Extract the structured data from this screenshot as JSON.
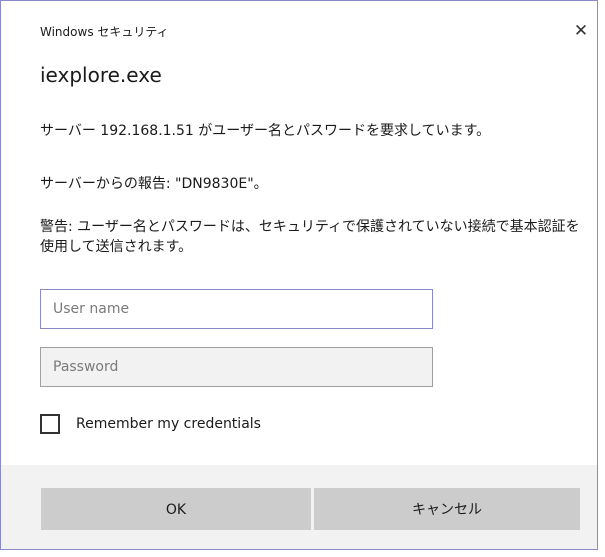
{
  "dialog": {
    "title": "Windows セキュリティ",
    "close_glyph": "✕",
    "app_name": "iexplore.exe",
    "message_request": "サーバー 192.168.1.51 がユーザー名とパスワードを要求しています。",
    "message_report": "サーバーからの報告: \"DN9830E\"。",
    "message_warning": "警告: ユーザー名とパスワードは、セキュリティで保護されていない接続で基本認証を使用して送信されます。"
  },
  "form": {
    "username_placeholder": "User name",
    "username_value": "",
    "password_placeholder": "Password",
    "password_value": "",
    "remember_label": "Remember my credentials",
    "remember_checked": false
  },
  "buttons": {
    "ok_label": "OK",
    "cancel_label": "キャンセル"
  },
  "colors": {
    "accent_border": "#8a8ac8",
    "button_bg": "#cccccc",
    "footer_bg": "#f2f2f2"
  }
}
